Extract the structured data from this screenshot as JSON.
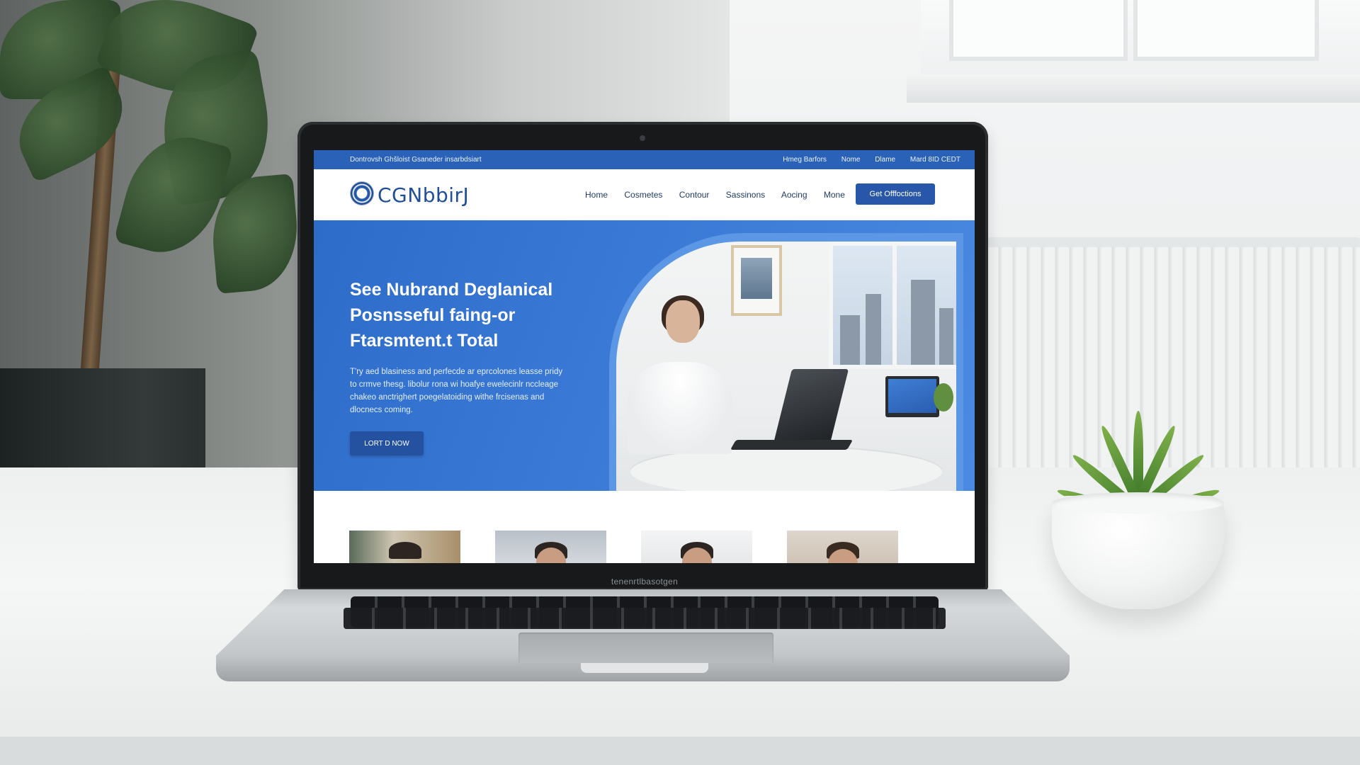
{
  "site": {
    "topbar": {
      "left_text": "Dontrovsh Ghšloist Gsaneder insarbdsiart",
      "right_links": [
        "Hmeg Barfors",
        "Nome",
        "Dlame",
        "Mard 8ID CEDT"
      ]
    },
    "brand": {
      "logo_text": "CGNbbirJ",
      "logo_icon": "shield-emblem-icon"
    },
    "nav": {
      "links": [
        "Home",
        "Cosmetes",
        "Contour",
        "Sassinons",
        "Aocing",
        "Mone"
      ],
      "cta_label": "Get Offfoctions"
    },
    "hero": {
      "title_lines": [
        "See Nubrand Deglanical",
        "Posnsseful faing-or",
        "Ftarsmtent.t Total"
      ],
      "body_lines": [
        "T'ry aed blasiness and perfecde ar eprcolones leasse pridy",
        "to crmve thesg. libolur rona wi hoafye ewelecinlr nccleage",
        "chakeo anctrighert poegelatoiding withe frcisenas and",
        "dlocnecs coming."
      ],
      "button_label": "LORT D NOW"
    },
    "cards": {
      "count_visible": 4
    }
  },
  "device": {
    "laptop_chin_label": "tenenrtlbasotgen"
  },
  "colors": {
    "topbar": "#2a62b8",
    "hero": "#3a7ad6",
    "cta": "#2856a8",
    "brand_text": "#1f4f99"
  }
}
